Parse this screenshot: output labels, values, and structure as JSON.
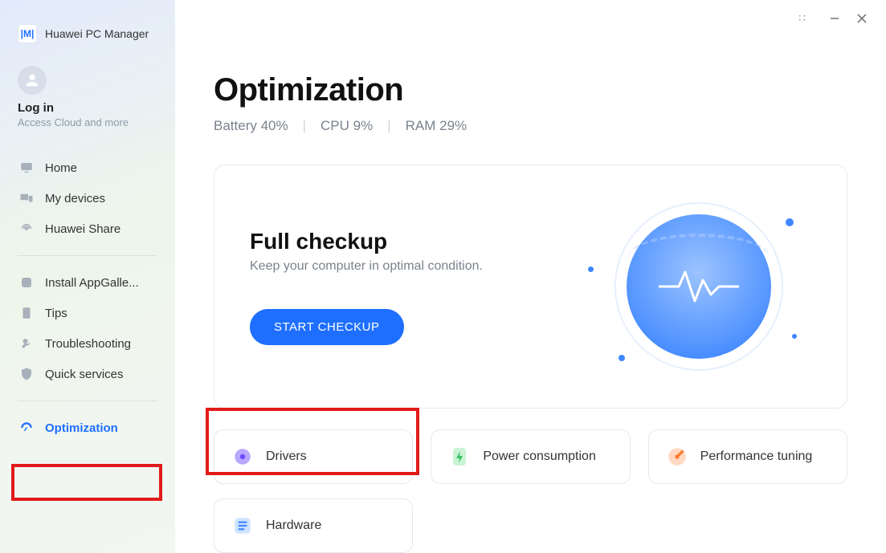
{
  "app": {
    "title": "Huawei PC Manager",
    "logo_text": "|M|"
  },
  "account": {
    "login_label": "Log in",
    "sub_label": "Access Cloud and more"
  },
  "nav": {
    "group1": [
      {
        "label": "Home"
      },
      {
        "label": "My devices"
      },
      {
        "label": "Huawei Share"
      }
    ],
    "group2": [
      {
        "label": "Install AppGalle..."
      },
      {
        "label": "Tips"
      },
      {
        "label": "Troubleshooting"
      },
      {
        "label": "Quick services"
      }
    ],
    "group3": [
      {
        "label": "Optimization"
      }
    ]
  },
  "page": {
    "title": "Optimization",
    "stats": {
      "battery": "Battery 40%",
      "cpu": "CPU 9%",
      "ram": "RAM 29%"
    }
  },
  "checkup": {
    "title": "Full checkup",
    "subtitle": "Keep your computer in optimal condition.",
    "button": "START CHECKUP"
  },
  "tiles": {
    "drivers": "Drivers",
    "power": "Power consumption",
    "perf": "Performance tuning",
    "hardware": "Hardware"
  }
}
